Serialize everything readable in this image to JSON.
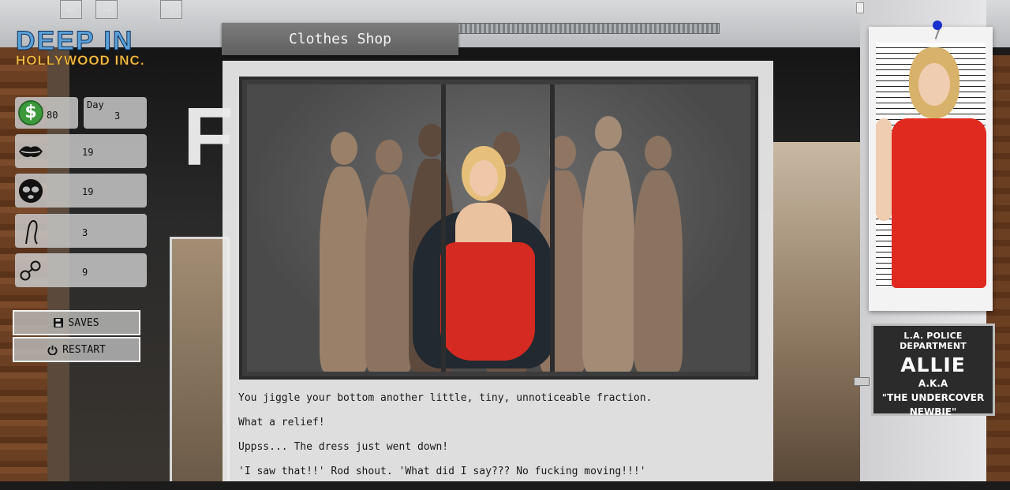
{
  "nav": {
    "back_icon": "arrow-left-icon",
    "forward_icon": "arrow-right-icon",
    "collapse_icon": "chevron-left-icon"
  },
  "logo": {
    "line1": "DEEP IN",
    "line2": "HOLLYWOOD INC."
  },
  "stats": {
    "money": {
      "icon": "dollar-coin-icon",
      "value": "80"
    },
    "day": {
      "label": "Day",
      "value": "3"
    },
    "lips": {
      "icon": "lips-icon",
      "value": "19"
    },
    "mask": {
      "icon": "mask-icon",
      "value": "19"
    },
    "whip": {
      "icon": "whip-icon",
      "value": "3"
    },
    "handcuffs": {
      "icon": "handcuffs-icon",
      "value": "9"
    }
  },
  "menu": {
    "saves_label": "SAVES",
    "restart_label": "RESTART"
  },
  "location": {
    "title": "Clothes Shop"
  },
  "story": {
    "lines": [
      "You jiggle your bottom another little, tiny, unnoticeable fraction.",
      "What a relief!",
      "Uppss... The dress just went down!",
      "'I saw that!!' Rod shout. 'What did I say??? No fucking moving!!!'"
    ]
  },
  "character": {
    "department": "L.A. POLICE DEPARTMENT",
    "name": "ALLIE",
    "aka": "A.K.A",
    "nickname_line1": "\"THE UNDERCOVER",
    "nickname_line2": "NEWBIE\""
  },
  "colors": {
    "dress": "#d42a22",
    "money_green": "#3c9a3c",
    "title_bar": "#6e6e6e"
  }
}
